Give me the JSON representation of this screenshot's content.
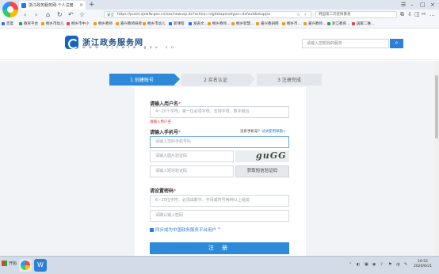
{
  "browser": {
    "tab_title": "浙江政务服务网-个人注册",
    "tab_close": "×",
    "new_tab": "+",
    "window_controls": [
      "☰",
      "–",
      "□",
      "×"
    ],
    "nav": {
      "back": "‹",
      "forward": "›",
      "home": "⌂",
      "reload": "↻",
      "undo": "↶",
      "star": "☆"
    },
    "address": {
      "secure_label": "安全",
      "url": "https://puser.zjzwfw.gov.cn/sso/newusp.do?action=regitstaponetype=default&stupjsa"
    },
    "web_search_text": "韩国第二次疫情暴发",
    "toolbar_icons": [
      "⧉",
      "⇩",
      "◫",
      "✂",
      "…"
    ],
    "bookmarks": [
      {
        "label": "百度",
        "color": "#2b6ee8"
      },
      {
        "label": "教育平台",
        "color": "#2e9d48"
      },
      {
        "label": "桐乡市幼儿",
        "color": "#f09a1e"
      },
      {
        "label": "桐乡市中小",
        "color": "#e04848"
      },
      {
        "label": "桐乡教师",
        "color": "#f09a1e"
      },
      {
        "label": "嘉兴教师研修",
        "color": "#f09a1e"
      },
      {
        "label": "桐乡市幼儿",
        "color": "#f09a1e"
      },
      {
        "label": "新课程",
        "color": "#2b6ee8"
      },
      {
        "label": "发表文…",
        "color": "#2b6ee8"
      },
      {
        "label": "桐乡教师…",
        "color": "#f09a1e"
      },
      {
        "label": "桐乡智慧…",
        "color": "#f09a1e"
      },
      {
        "label": "嘉兴教研网",
        "color": "#f09a1e"
      },
      {
        "label": "桐乡市…",
        "color": "#f09a1e"
      },
      {
        "label": "嘉兴教师…",
        "color": "#f09a1e"
      },
      {
        "label": "浙江教育…",
        "color": "#2e9d48"
      },
      {
        "label": "国家二维…",
        "color": "#e04848"
      }
    ]
  },
  "site": {
    "name": "浙江政务服务网",
    "url_text": "w w w . z j z w f w . g o v . c n",
    "search_placeholder": "请输入您想找的服务",
    "search_icon": "⌕"
  },
  "steps": [
    "1 创建账号",
    "2 实名认证",
    "3 注册完成"
  ],
  "form": {
    "username_label": "请输入用户名",
    "required_mark": "*",
    "username_placeholder": "4~20个字符，第一位必须字母，支持字母、数字组合",
    "username_error": "请输入用户名",
    "phone_label": "请输入手机号",
    "no_phone_text": "没有手机号？",
    "email_register_link": "试试使用邮箱>",
    "phone_placeholder": "请输入您的手机号码",
    "image_code_placeholder": "请输入图片验证码",
    "captcha_text": "guGG",
    "sms_code_placeholder": "请输入短信验证码",
    "sms_button": "获取短信验证码",
    "password_label": "请设置密码",
    "password_placeholder": "6~20位字符，必须由数字、字母或符号两种以上组成",
    "password_confirm_placeholder": "请确认输入密码",
    "agree_text": "同步成为中国政务服务平台用户",
    "submit_label": "注 册"
  },
  "taskbar": {
    "start_label": "开始",
    "apps": [
      {
        "name": "browser",
        "color": "#e8e8e8"
      },
      {
        "name": "edge-like",
        "color": "#2b7fd6"
      }
    ],
    "tray_icons": [
      "⌃",
      "◐",
      "▣",
      "◉",
      "♪",
      "⚑",
      "中",
      "✎"
    ],
    "time": "16:52",
    "date": "2020/6/21"
  }
}
